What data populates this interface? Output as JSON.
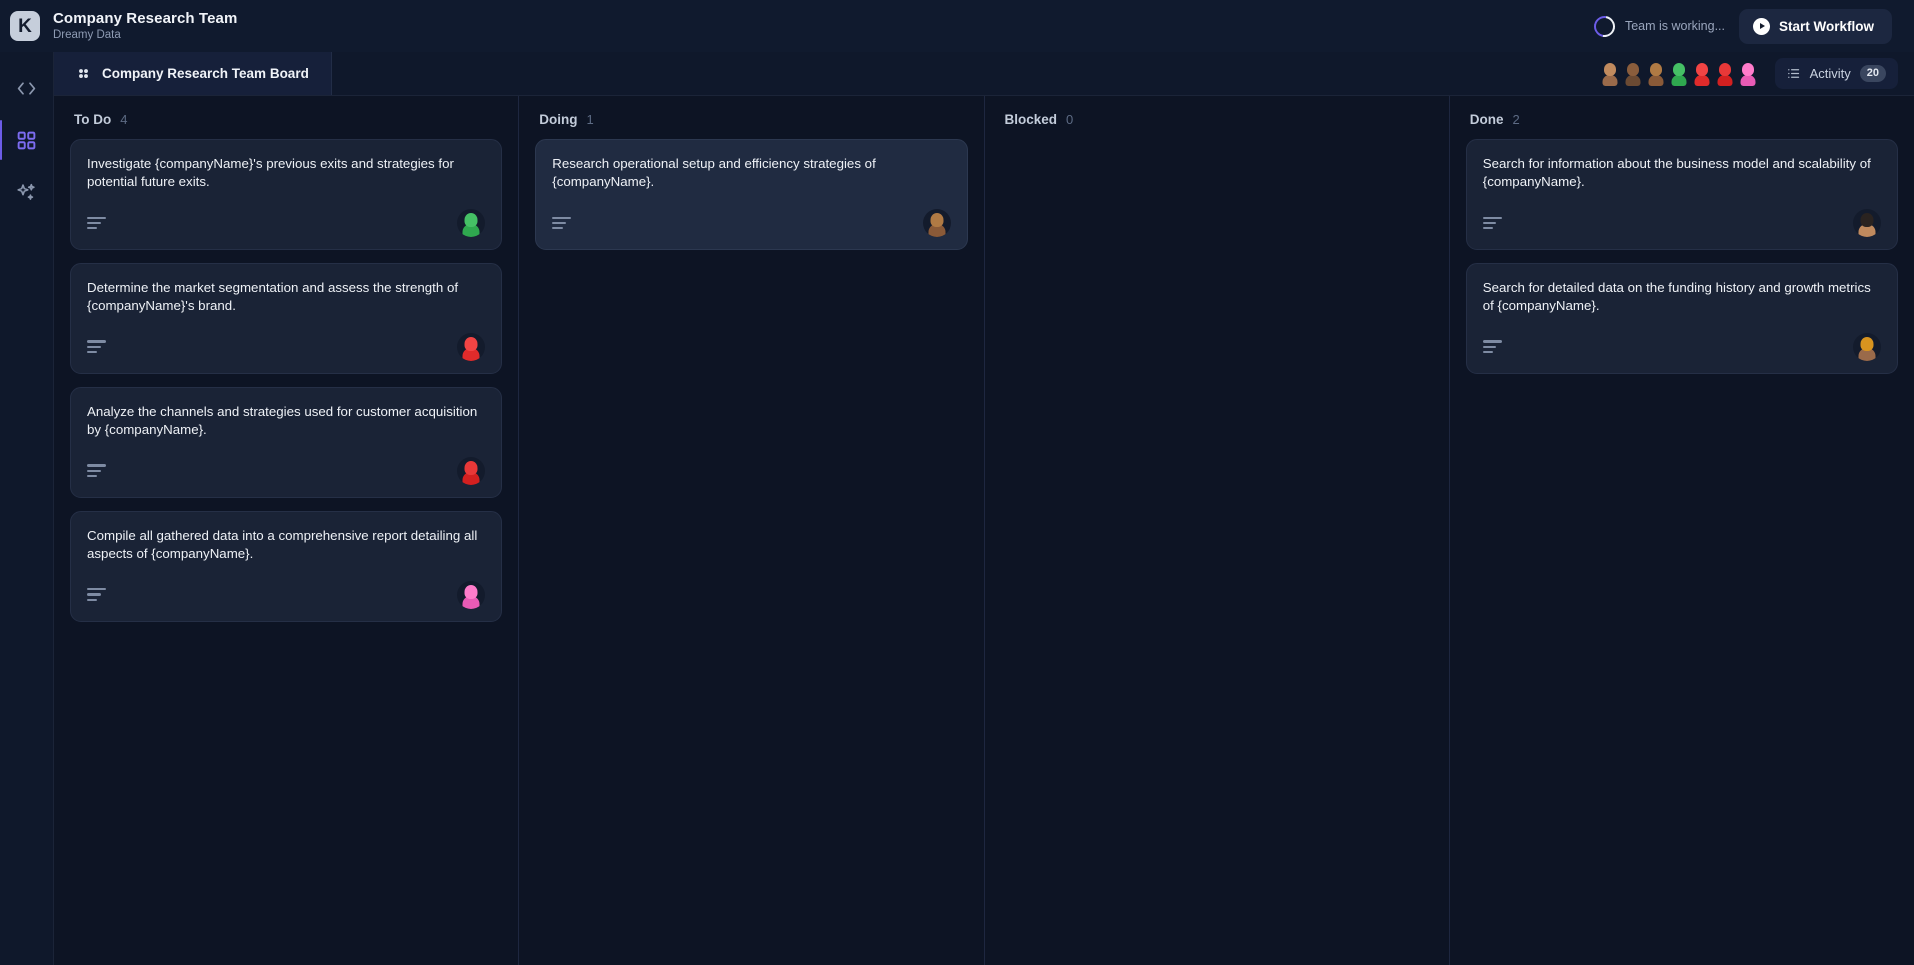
{
  "header": {
    "logo_letter": "K",
    "title": "Company Research Team",
    "subtitle": "Dreamy Data",
    "status_text": "Team is working...",
    "start_workflow_label": "Start Workflow"
  },
  "rail": {
    "items": [
      {
        "icon": "code-icon",
        "active": false
      },
      {
        "icon": "grid-icon",
        "active": true
      },
      {
        "icon": "sparkles-icon",
        "active": false
      }
    ]
  },
  "tabbar": {
    "tab_label": "Company Research Team  Board",
    "activity_label": "Activity",
    "activity_count": "20",
    "avatars": [
      {
        "name": "member-1",
        "body": "#9a6a4a",
        "head": "#c08a5e"
      },
      {
        "name": "member-2",
        "body": "#6b4a33",
        "head": "#8a5d3c"
      },
      {
        "name": "member-3",
        "body": "#8a5a38",
        "head": "#b07a44"
      },
      {
        "name": "member-4",
        "body": "#2fa84f",
        "head": "#45c065"
      },
      {
        "name": "member-5",
        "body": "#e02b2b",
        "head": "#f24444"
      },
      {
        "name": "member-6",
        "body": "#d32020",
        "head": "#e83838"
      },
      {
        "name": "member-7",
        "body": "#e85bb5",
        "head": "#ff7ccb"
      }
    ]
  },
  "board": {
    "columns": [
      {
        "title": "To Do",
        "count": "4",
        "cards": [
          {
            "text": "Investigate {companyName}'s previous exits and strategies for potential future exits.",
            "highlight": false,
            "avatar": {
              "body": "#2fa84f",
              "head": "#45c065"
            }
          },
          {
            "text": "Determine the market segmentation and assess the strength of {companyName}'s brand.",
            "highlight": false,
            "avatar": {
              "body": "#e02b2b",
              "head": "#f24444"
            }
          },
          {
            "text": "Analyze the channels and strategies used for customer acquisition by {companyName}.",
            "highlight": false,
            "avatar": {
              "body": "#d32020",
              "head": "#e83838"
            }
          },
          {
            "text": "Compile all gathered data into a comprehensive report detailing all aspects of {companyName}.",
            "highlight": false,
            "avatar": {
              "body": "#e85bb5",
              "head": "#ff7ccb"
            }
          }
        ]
      },
      {
        "title": "Doing",
        "count": "1",
        "cards": [
          {
            "text": "Research operational setup and efficiency strategies of {companyName}.",
            "highlight": true,
            "avatar": {
              "body": "#8a5a38",
              "head": "#b07a44"
            }
          }
        ]
      },
      {
        "title": "Blocked",
        "count": "0",
        "cards": []
      },
      {
        "title": "Done",
        "count": "2",
        "cards": [
          {
            "text": "Search for information about the business model and scalability of {companyName}.",
            "highlight": false,
            "avatar": {
              "body": "#c08a5e",
              "head": "#2a2320"
            }
          },
          {
            "text": "Search for detailed data on the funding history and growth metrics of {companyName}.",
            "highlight": false,
            "avatar": {
              "body": "#9a6a4a",
              "head": "#d8941f"
            }
          }
        ]
      }
    ]
  },
  "colors": {
    "page_bg": "#0d1424",
    "panel_bg": "#101a2e",
    "card_bg": "#1a2336",
    "accent": "#6c5ce7"
  }
}
